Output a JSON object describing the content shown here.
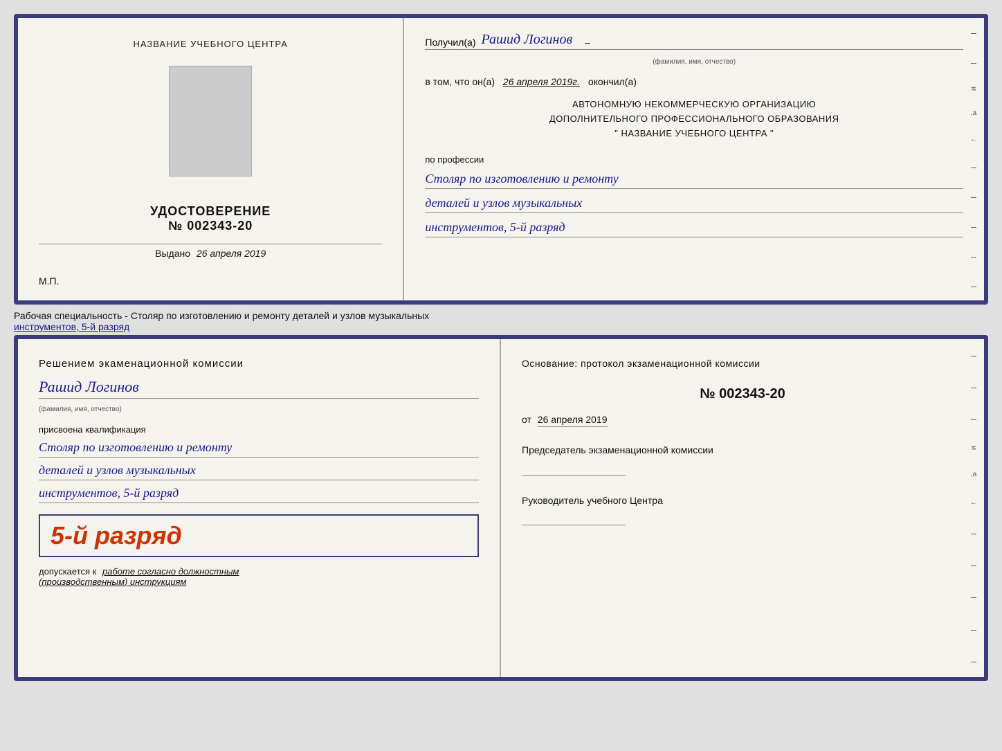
{
  "top_document": {
    "left": {
      "org_name": "НАЗВАНИЕ УЧЕБНОГО ЦЕНТРА",
      "cert_title": "УДОСТОВЕРЕНИЕ",
      "cert_number_prefix": "№",
      "cert_number": "002343-20",
      "issued_label": "Выдано",
      "issued_date": "26 апреля 2019",
      "mp_label": "М.П."
    },
    "right": {
      "received_label": "Получил(а)",
      "recipient_name": "Рашид Логинов",
      "fio_label": "(фамилия, имя, отчество)",
      "date_label": "в том, что он(а)",
      "date_value": "26 апреля 2019г.",
      "finished_label": "окончил(а)",
      "org_line1": "АВТОНОМНУЮ НЕКОММЕРЧЕСКУЮ ОРГАНИЗАЦИЮ",
      "org_line2": "ДОПОЛНИТЕЛЬНОГО ПРОФЕССИОНАЛЬНОГО ОБРАЗОВАНИЯ",
      "org_line3": "\"    НАЗВАНИЕ УЧЕБНОГО ЦЕНТРА    \"",
      "profession_label": "по профессии",
      "profession_line1": "Столяр по изготовлению и ремонту",
      "profession_line2": "деталей и узлов музыкальных",
      "profession_line3": "инструментов, 5-й разряд"
    }
  },
  "middle_text": {
    "prefix": "Рабочая специальность - Столяр по изготовлению и ремонту деталей и узлов музыкальных",
    "suffix_underline": "инструментов, 5-й разряд"
  },
  "bottom_document": {
    "left": {
      "decision_text": "Решением экаменационной комиссии",
      "person_name": "Рашид Логинов",
      "fio_label": "(фамилия, имя, отчество)",
      "qualification_label": "присвоена квалификация",
      "qualification_line1": "Столяр по изготовлению и ремонту",
      "qualification_line2": "деталей и узлов музыкальных",
      "qualification_line3": "инструментов, 5-й разряд",
      "rank_text": "5-й разряд",
      "admission_prefix": "допускается к",
      "admission_italic": "работе согласно должностным",
      "admission_italic2": "(производственным) инструкциям"
    },
    "right": {
      "basis_label": "Основание: протокол экзаменационной комиссии",
      "protocol_number": "№  002343-20",
      "date_prefix": "от",
      "date_value": "26 апреля 2019",
      "chairman_title": "Председатель экзаменационной комиссии",
      "director_title": "Руководитель учебного Центра"
    }
  }
}
